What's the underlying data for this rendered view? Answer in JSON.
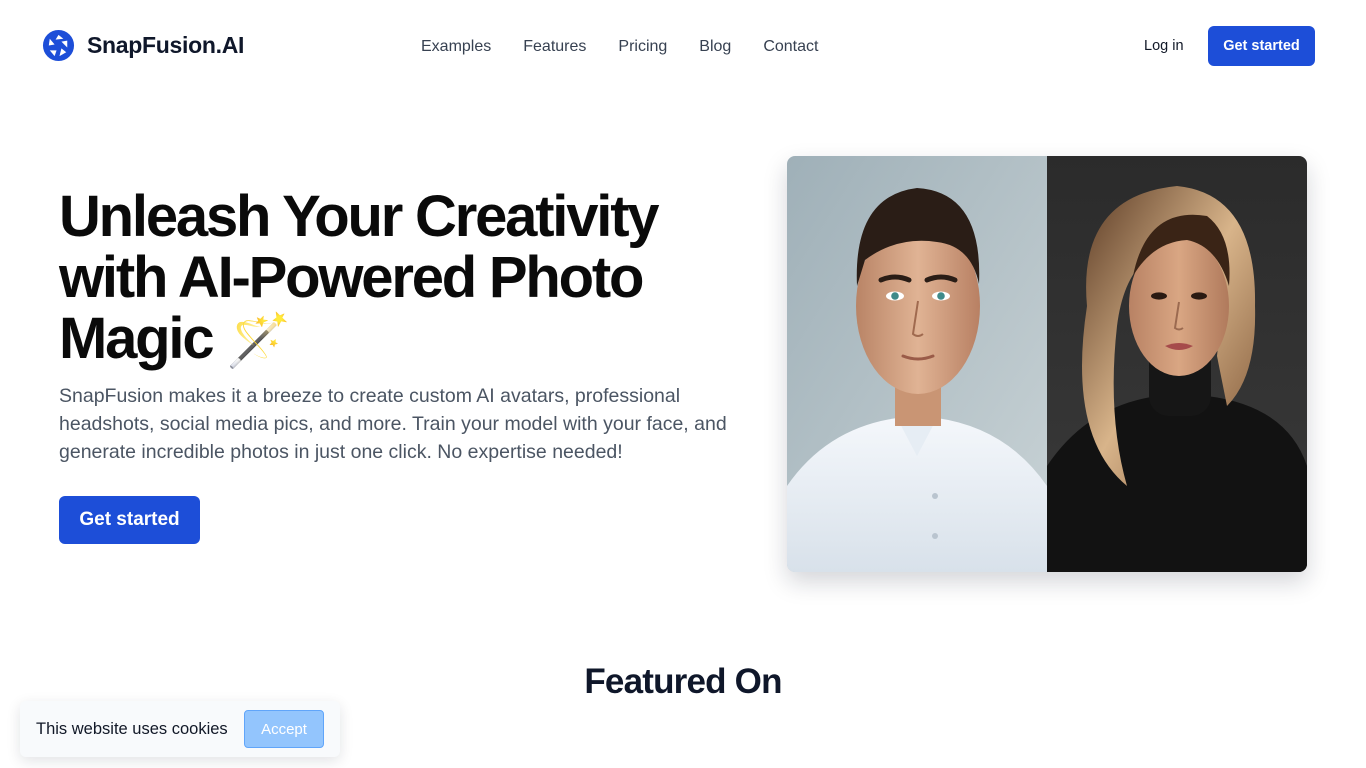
{
  "brand": {
    "name": "SnapFusion.AI",
    "icon": "aperture-icon",
    "accent": "#1d4ed8"
  },
  "nav": {
    "items": [
      {
        "label": "Examples"
      },
      {
        "label": "Features"
      },
      {
        "label": "Pricing"
      },
      {
        "label": "Blog"
      },
      {
        "label": "Contact"
      }
    ],
    "login_label": "Log in",
    "cta_label": "Get started"
  },
  "hero": {
    "title_line1": "Unleash Your Creativity",
    "title_line2": "with AI-Powered Photo",
    "title_line3": "Magic",
    "title_emoji": "🪄",
    "subtitle": "SnapFusion makes it a breeze to create custom AI avatars, professional headshots, social media pics, and more. Train your model with your face, and generate incredible photos in just one click. No expertise needed!",
    "cta_label": "Get started",
    "image": {
      "description": "two-portrait-collage-icon"
    }
  },
  "featured": {
    "title": "Featured On"
  },
  "cookie": {
    "text": "This website uses cookies",
    "accept_label": "Accept",
    "accept_color": "#93c5fd"
  }
}
